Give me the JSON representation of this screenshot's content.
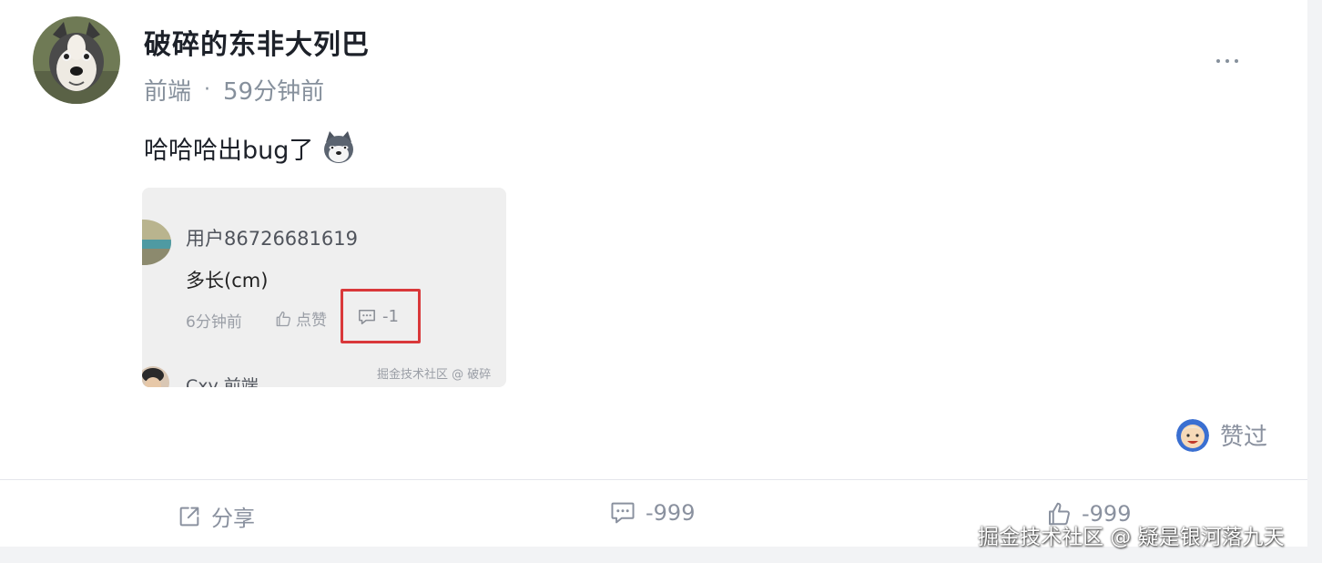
{
  "author": {
    "name": "破碎的东非大列巴",
    "avatar_icon": "husky-dog-avatar"
  },
  "meta": {
    "circle": "前端",
    "separator": "·",
    "time": "59分钟前"
  },
  "post": {
    "text": "哈哈哈出bug了",
    "emoji_icon": "husky-emoji"
  },
  "screenshot": {
    "user_name": "用户86726681619",
    "comment": "多长(cm)",
    "time": "6分钟前",
    "like_label": "点赞",
    "reply_count": "-1",
    "watermark": "掘金技术社区 @ 破碎",
    "next_user": "Cxy  前端",
    "highlight_color": "#d9383a"
  },
  "liked_by": {
    "label": "赞过",
    "avatar_icon": "cartoon-face-avatar"
  },
  "actions": {
    "share_label": "分享",
    "comment_count": "-999",
    "like_count": "-999"
  },
  "watermark_text": "掘金技术社区 @ 疑是银河落九天",
  "colors": {
    "text_primary": "#1d2129",
    "text_secondary": "#86909c",
    "divider": "#e4e6eb",
    "background_gray": "#f2f3f5"
  }
}
